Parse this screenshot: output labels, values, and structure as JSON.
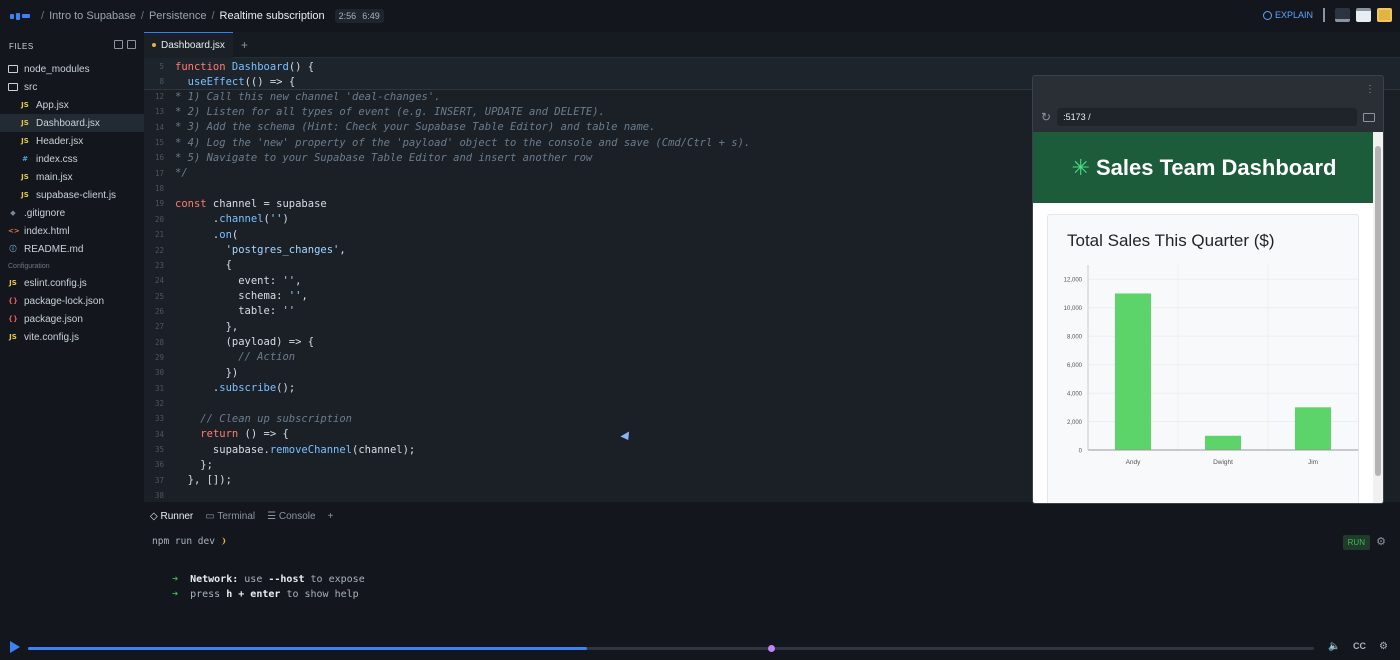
{
  "topbar": {
    "breadcrumbs": [
      "Intro to Supabase",
      "Persistence",
      "Realtime subscription"
    ],
    "time_current": "2:56",
    "time_total": "6:49",
    "explain_label": "EXPLAIN"
  },
  "sidebar": {
    "header": "FILES",
    "items": [
      {
        "name": "node_modules",
        "type": "folder"
      },
      {
        "name": "src",
        "type": "folder"
      },
      {
        "name": "App.jsx",
        "type": "js"
      },
      {
        "name": "Dashboard.jsx",
        "type": "js",
        "selected": true
      },
      {
        "name": "Header.jsx",
        "type": "js"
      },
      {
        "name": "index.css",
        "type": "css"
      },
      {
        "name": "main.jsx",
        "type": "js"
      },
      {
        "name": "supabase-client.js",
        "type": "js"
      },
      {
        "name": ".gitignore",
        "type": "git"
      },
      {
        "name": "index.html",
        "type": "html"
      },
      {
        "name": "README.md",
        "type": "md"
      }
    ],
    "config_label": "Configuration",
    "config_items": [
      {
        "name": "eslint.config.js",
        "type": "js"
      },
      {
        "name": "package-lock.json",
        "type": "json"
      },
      {
        "name": "package.json",
        "type": "json"
      },
      {
        "name": "vite.config.js",
        "type": "js"
      }
    ]
  },
  "editor": {
    "tab_label": "Dashboard.jsx",
    "sticky": [
      {
        "num": "5",
        "text": "function Dashboard() {"
      },
      {
        "num": "8",
        "text": "  useEffect(() => {"
      }
    ],
    "lines": [
      {
        "num": "12",
        "text": "* 1) Call this new channel 'deal-changes'."
      },
      {
        "num": "13",
        "text": "* 2) Listen for all types of event (e.g. INSERT, UPDATE and DELETE)."
      },
      {
        "num": "14",
        "text": "* 3) Add the schema (Hint: Check your Supabase Table Editor) and table name."
      },
      {
        "num": "15",
        "text": "* 4) Log the 'new' property of the 'payload' object to the console and save (Cmd/Ctrl + s)."
      },
      {
        "num": "16",
        "text": "* 5) Navigate to your Supabase Table Editor and insert another row"
      },
      {
        "num": "17",
        "text": "*/"
      },
      {
        "num": "18",
        "text": ""
      },
      {
        "num": "19",
        "text": "const channel = supabase"
      },
      {
        "num": "20",
        "text": "      .channel('')"
      },
      {
        "num": "21",
        "text": "      .on("
      },
      {
        "num": "22",
        "text": "        'postgres_changes',"
      },
      {
        "num": "23",
        "text": "        {"
      },
      {
        "num": "24",
        "text": "          event: '',"
      },
      {
        "num": "25",
        "text": "          schema: '',"
      },
      {
        "num": "26",
        "text": "          table: ''"
      },
      {
        "num": "27",
        "text": "        },"
      },
      {
        "num": "28",
        "text": "        (payload) => {"
      },
      {
        "num": "29",
        "text": "          // Action"
      },
      {
        "num": "30",
        "text": "        })"
      },
      {
        "num": "31",
        "text": "      .subscribe();"
      },
      {
        "num": "32",
        "text": ""
      },
      {
        "num": "33",
        "text": "    // Clean up subscription"
      },
      {
        "num": "34",
        "text": "    return () => {"
      },
      {
        "num": "35",
        "text": "      supabase.removeChannel(channel);"
      },
      {
        "num": "36",
        "text": "    };"
      },
      {
        "num": "37",
        "text": "  }, []);"
      },
      {
        "num": "38",
        "text": ""
      }
    ]
  },
  "browser": {
    "url": ":5173 /",
    "dashboard_title": "Sales Team Dashboard",
    "card_title": "Total Sales This Quarter ($)"
  },
  "chart_data": {
    "type": "bar",
    "categories": [
      "Andy",
      "Dwight",
      "Jim"
    ],
    "values": [
      11000,
      1000,
      3000
    ],
    "ylim": [
      0,
      13000
    ],
    "yticks": [
      0,
      2000,
      4000,
      6000,
      8000,
      10000,
      12000
    ],
    "ytick_labels": [
      "0",
      "2,000",
      "4,000",
      "6,000",
      "8,000",
      "10,000",
      "12,000"
    ],
    "color": "#5cd46a",
    "grid": true
  },
  "panel": {
    "tabs": [
      "Runner",
      "Terminal",
      "Console"
    ],
    "command": "npm run dev",
    "run_label": "RUN",
    "term_lines": [
      {
        "label": "Network:",
        "mid": "use",
        "bold": "--host",
        "rest": "to expose"
      },
      {
        "label": "press",
        "mid": "",
        "bold": "h + enter",
        "rest": "to show help"
      }
    ]
  },
  "player": {
    "progress": 0.435,
    "cc_label": "CC"
  }
}
